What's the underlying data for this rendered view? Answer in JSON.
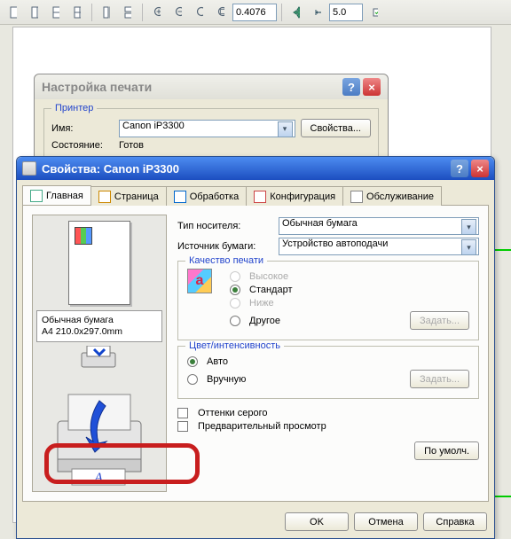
{
  "toolbar": {
    "zoom_value": "0.4076",
    "snap_value": "5.0"
  },
  "print_setup": {
    "title": "Настройка печати",
    "group": "Принтер",
    "name_label": "Имя:",
    "printer_name": "Canon iP3300",
    "properties_btn": "Свойства...",
    "status_label": "Состояние:",
    "status_value": "Готов"
  },
  "props": {
    "title": "Свойства: Canon iP3300",
    "tabs": {
      "main": "Главная",
      "page": "Страница",
      "process": "Обработка",
      "config": "Конфигурация",
      "service": "Обслуживание"
    },
    "media_type_label": "Тип носителя:",
    "media_type_value": "Обычная бумага",
    "paper_source_label": "Источник бумаги:",
    "paper_source_value": "Устройство автоподачи",
    "quality_legend": "Качество печати",
    "quality": {
      "high": "Высокое",
      "standard": "Стандарт",
      "low": "Ниже",
      "other": "Другое"
    },
    "set_btn": "Задать...",
    "intensity_legend": "Цвет/интенсивность",
    "intensity": {
      "auto": "Авто",
      "manual": "Вручную"
    },
    "greyscale": "Оттенки серого",
    "preview": "Предварительный просмотр",
    "paper_info1": "Обычная бумага",
    "paper_info2": "A4 210.0x297.0mm",
    "defaults_btn": "По умолч.",
    "ok": "OK",
    "cancel": "Отмена",
    "help": "Справка"
  }
}
